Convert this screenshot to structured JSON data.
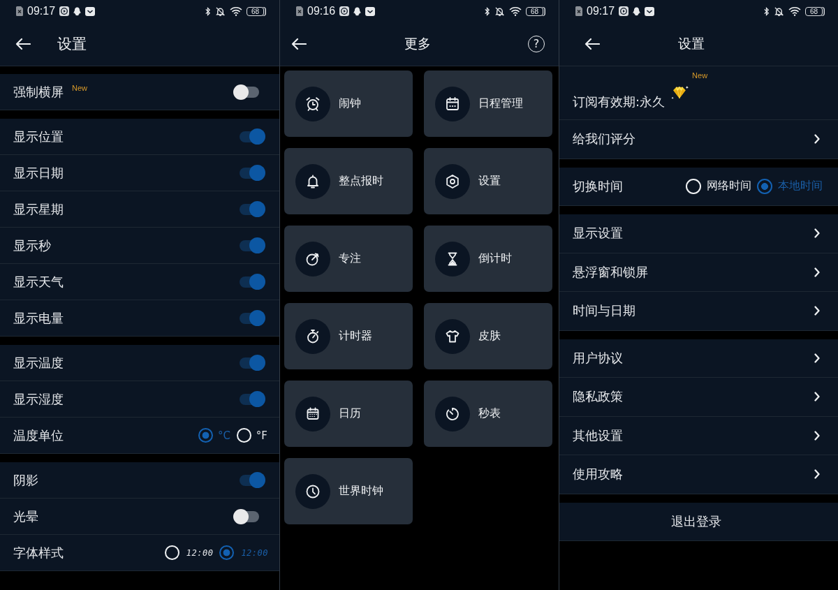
{
  "screens": [
    {
      "kind": "toggle_settings",
      "status_bar": {
        "time": "09:17",
        "battery": "68"
      },
      "header": {
        "title": "设置"
      },
      "groups": [
        {
          "rows": [
            {
              "kind": "toggle",
              "label": "强制横屏",
              "badge": "New",
              "on": false
            }
          ]
        },
        {
          "rows": [
            {
              "kind": "toggle",
              "label": "显示位置",
              "on": true
            },
            {
              "kind": "toggle",
              "label": "显示日期",
              "on": true
            },
            {
              "kind": "toggle",
              "label": "显示星期",
              "on": true
            },
            {
              "kind": "toggle",
              "label": "显示秒",
              "on": true
            },
            {
              "kind": "toggle",
              "label": "显示天气",
              "on": true
            },
            {
              "kind": "toggle",
              "label": "显示电量",
              "on": true
            }
          ]
        },
        {
          "rows": [
            {
              "kind": "toggle",
              "label": "显示温度",
              "on": true
            },
            {
              "kind": "toggle",
              "label": "显示湿度",
              "on": true
            },
            {
              "kind": "radio",
              "label": "温度单位",
              "options": [
                {
                  "kind": "text",
                  "label": "°C",
                  "selected": true
                },
                {
                  "kind": "text",
                  "label": "°F",
                  "selected": false
                }
              ]
            }
          ]
        },
        {
          "rows": [
            {
              "kind": "toggle",
              "label": "阴影",
              "on": true
            },
            {
              "kind": "toggle",
              "label": "光晕",
              "on": false
            },
            {
              "kind": "radio",
              "label": "字体样式",
              "options": [
                {
                  "kind": "digital",
                  "label": "12:00",
                  "selected": false
                },
                {
                  "kind": "digital",
                  "label": "12:00",
                  "selected": true
                }
              ]
            }
          ]
        }
      ]
    },
    {
      "kind": "tile_grid",
      "status_bar": {
        "time": "09:16",
        "battery": "68"
      },
      "header": {
        "title": "更多",
        "help": "?"
      },
      "tiles": [
        {
          "kind": "alarm",
          "label": "闹钟"
        },
        {
          "kind": "schedule",
          "label": "日程管理"
        },
        {
          "kind": "bell",
          "label": "整点报时"
        },
        {
          "kind": "gear",
          "label": "设置"
        },
        {
          "kind": "focus",
          "label": "专注"
        },
        {
          "kind": "hourglass",
          "label": "倒计时"
        },
        {
          "kind": "stopwatch",
          "label": "计时器"
        },
        {
          "kind": "shirt",
          "label": "皮肤"
        },
        {
          "kind": "calendar",
          "label": "日历"
        },
        {
          "kind": "dial",
          "label": "秒表"
        },
        {
          "kind": "clock",
          "label": "世界时钟"
        }
      ]
    },
    {
      "kind": "account_settings",
      "status_bar": {
        "time": "09:17",
        "battery": "68"
      },
      "header": {
        "title": "设置"
      },
      "groups": [
        {
          "rows": [
            {
              "kind": "subscription",
              "label": "订阅有效期:永久",
              "badge": "New"
            },
            {
              "kind": "link",
              "label": "给我们评分"
            }
          ]
        },
        {
          "rows": [
            {
              "kind": "radio",
              "label": "切换时间",
              "options": [
                {
                  "kind": "text",
                  "label": "网络时间",
                  "selected": false
                },
                {
                  "kind": "text",
                  "label": "本地时间",
                  "selected": true
                }
              ]
            }
          ]
        },
        {
          "rows": [
            {
              "kind": "link",
              "label": "显示设置"
            },
            {
              "kind": "link",
              "label": "悬浮窗和锁屏"
            },
            {
              "kind": "link",
              "label": "时间与日期"
            }
          ]
        },
        {
          "rows": [
            {
              "kind": "link",
              "label": "用户协议"
            },
            {
              "kind": "link",
              "label": "隐私政策"
            },
            {
              "kind": "link",
              "label": "其他设置"
            },
            {
              "kind": "link",
              "label": "使用攻略"
            }
          ]
        },
        {
          "rows": [
            {
              "kind": "action",
              "label": "退出登录"
            }
          ]
        }
      ]
    }
  ]
}
